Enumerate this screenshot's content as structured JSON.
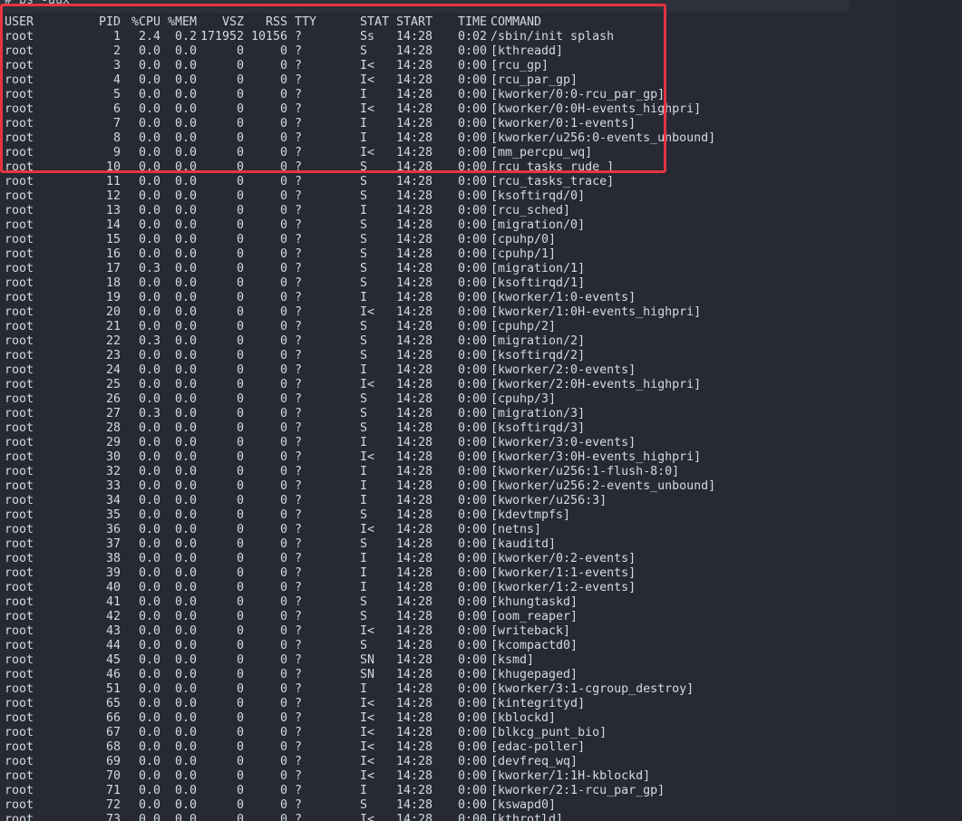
{
  "command": "# ps -aux",
  "columns": [
    "USER",
    "PID",
    "%CPU",
    "%MEM",
    "VSZ",
    "RSS",
    "TTY",
    "STAT",
    "START",
    "TIME",
    "COMMAND"
  ],
  "rows": [
    {
      "user": "root",
      "pid": "1",
      "cpu": "2.4",
      "mem": "0.2",
      "vsz": "171952",
      "rss": "10156",
      "tty": "?",
      "stat": "Ss",
      "start": "14:28",
      "time": "0:02",
      "cmd": "/sbin/init splash"
    },
    {
      "user": "root",
      "pid": "2",
      "cpu": "0.0",
      "mem": "0.0",
      "vsz": "0",
      "rss": "0",
      "tty": "?",
      "stat": "S",
      "start": "14:28",
      "time": "0:00",
      "cmd": "[kthreadd]"
    },
    {
      "user": "root",
      "pid": "3",
      "cpu": "0.0",
      "mem": "0.0",
      "vsz": "0",
      "rss": "0",
      "tty": "?",
      "stat": "I<",
      "start": "14:28",
      "time": "0:00",
      "cmd": "[rcu_gp]"
    },
    {
      "user": "root",
      "pid": "4",
      "cpu": "0.0",
      "mem": "0.0",
      "vsz": "0",
      "rss": "0",
      "tty": "?",
      "stat": "I<",
      "start": "14:28",
      "time": "0:00",
      "cmd": "[rcu_par_gp]"
    },
    {
      "user": "root",
      "pid": "5",
      "cpu": "0.0",
      "mem": "0.0",
      "vsz": "0",
      "rss": "0",
      "tty": "?",
      "stat": "I",
      "start": "14:28",
      "time": "0:00",
      "cmd": "[kworker/0:0-rcu_par_gp]"
    },
    {
      "user": "root",
      "pid": "6",
      "cpu": "0.0",
      "mem": "0.0",
      "vsz": "0",
      "rss": "0",
      "tty": "?",
      "stat": "I<",
      "start": "14:28",
      "time": "0:00",
      "cmd": "[kworker/0:0H-events_highpri]"
    },
    {
      "user": "root",
      "pid": "7",
      "cpu": "0.0",
      "mem": "0.0",
      "vsz": "0",
      "rss": "0",
      "tty": "?",
      "stat": "I",
      "start": "14:28",
      "time": "0:00",
      "cmd": "[kworker/0:1-events]"
    },
    {
      "user": "root",
      "pid": "8",
      "cpu": "0.0",
      "mem": "0.0",
      "vsz": "0",
      "rss": "0",
      "tty": "?",
      "stat": "I",
      "start": "14:28",
      "time": "0:00",
      "cmd": "[kworker/u256:0-events_unbound]"
    },
    {
      "user": "root",
      "pid": "9",
      "cpu": "0.0",
      "mem": "0.0",
      "vsz": "0",
      "rss": "0",
      "tty": "?",
      "stat": "I<",
      "start": "14:28",
      "time": "0:00",
      "cmd": "[mm_percpu_wq]"
    },
    {
      "user": "root",
      "pid": "10",
      "cpu": "0.0",
      "mem": "0.0",
      "vsz": "0",
      "rss": "0",
      "tty": "?",
      "stat": "S",
      "start": "14:28",
      "time": "0:00",
      "cmd": "[rcu_tasks_rude_]"
    },
    {
      "user": "root",
      "pid": "11",
      "cpu": "0.0",
      "mem": "0.0",
      "vsz": "0",
      "rss": "0",
      "tty": "?",
      "stat": "S",
      "start": "14:28",
      "time": "0:00",
      "cmd": "[rcu_tasks_trace]"
    },
    {
      "user": "root",
      "pid": "12",
      "cpu": "0.0",
      "mem": "0.0",
      "vsz": "0",
      "rss": "0",
      "tty": "?",
      "stat": "S",
      "start": "14:28",
      "time": "0:00",
      "cmd": "[ksoftirqd/0]"
    },
    {
      "user": "root",
      "pid": "13",
      "cpu": "0.0",
      "mem": "0.0",
      "vsz": "0",
      "rss": "0",
      "tty": "?",
      "stat": "I",
      "start": "14:28",
      "time": "0:00",
      "cmd": "[rcu_sched]"
    },
    {
      "user": "root",
      "pid": "14",
      "cpu": "0.0",
      "mem": "0.0",
      "vsz": "0",
      "rss": "0",
      "tty": "?",
      "stat": "S",
      "start": "14:28",
      "time": "0:00",
      "cmd": "[migration/0]"
    },
    {
      "user": "root",
      "pid": "15",
      "cpu": "0.0",
      "mem": "0.0",
      "vsz": "0",
      "rss": "0",
      "tty": "?",
      "stat": "S",
      "start": "14:28",
      "time": "0:00",
      "cmd": "[cpuhp/0]"
    },
    {
      "user": "root",
      "pid": "16",
      "cpu": "0.0",
      "mem": "0.0",
      "vsz": "0",
      "rss": "0",
      "tty": "?",
      "stat": "S",
      "start": "14:28",
      "time": "0:00",
      "cmd": "[cpuhp/1]"
    },
    {
      "user": "root",
      "pid": "17",
      "cpu": "0.3",
      "mem": "0.0",
      "vsz": "0",
      "rss": "0",
      "tty": "?",
      "stat": "S",
      "start": "14:28",
      "time": "0:00",
      "cmd": "[migration/1]"
    },
    {
      "user": "root",
      "pid": "18",
      "cpu": "0.0",
      "mem": "0.0",
      "vsz": "0",
      "rss": "0",
      "tty": "?",
      "stat": "S",
      "start": "14:28",
      "time": "0:00",
      "cmd": "[ksoftirqd/1]"
    },
    {
      "user": "root",
      "pid": "19",
      "cpu": "0.0",
      "mem": "0.0",
      "vsz": "0",
      "rss": "0",
      "tty": "?",
      "stat": "I",
      "start": "14:28",
      "time": "0:00",
      "cmd": "[kworker/1:0-events]"
    },
    {
      "user": "root",
      "pid": "20",
      "cpu": "0.0",
      "mem": "0.0",
      "vsz": "0",
      "rss": "0",
      "tty": "?",
      "stat": "I<",
      "start": "14:28",
      "time": "0:00",
      "cmd": "[kworker/1:0H-events_highpri]"
    },
    {
      "user": "root",
      "pid": "21",
      "cpu": "0.0",
      "mem": "0.0",
      "vsz": "0",
      "rss": "0",
      "tty": "?",
      "stat": "S",
      "start": "14:28",
      "time": "0:00",
      "cmd": "[cpuhp/2]"
    },
    {
      "user": "root",
      "pid": "22",
      "cpu": "0.3",
      "mem": "0.0",
      "vsz": "0",
      "rss": "0",
      "tty": "?",
      "stat": "S",
      "start": "14:28",
      "time": "0:00",
      "cmd": "[migration/2]"
    },
    {
      "user": "root",
      "pid": "23",
      "cpu": "0.0",
      "mem": "0.0",
      "vsz": "0",
      "rss": "0",
      "tty": "?",
      "stat": "S",
      "start": "14:28",
      "time": "0:00",
      "cmd": "[ksoftirqd/2]"
    },
    {
      "user": "root",
      "pid": "24",
      "cpu": "0.0",
      "mem": "0.0",
      "vsz": "0",
      "rss": "0",
      "tty": "?",
      "stat": "I",
      "start": "14:28",
      "time": "0:00",
      "cmd": "[kworker/2:0-events]"
    },
    {
      "user": "root",
      "pid": "25",
      "cpu": "0.0",
      "mem": "0.0",
      "vsz": "0",
      "rss": "0",
      "tty": "?",
      "stat": "I<",
      "start": "14:28",
      "time": "0:00",
      "cmd": "[kworker/2:0H-events_highpri]"
    },
    {
      "user": "root",
      "pid": "26",
      "cpu": "0.0",
      "mem": "0.0",
      "vsz": "0",
      "rss": "0",
      "tty": "?",
      "stat": "S",
      "start": "14:28",
      "time": "0:00",
      "cmd": "[cpuhp/3]"
    },
    {
      "user": "root",
      "pid": "27",
      "cpu": "0.3",
      "mem": "0.0",
      "vsz": "0",
      "rss": "0",
      "tty": "?",
      "stat": "S",
      "start": "14:28",
      "time": "0:00",
      "cmd": "[migration/3]"
    },
    {
      "user": "root",
      "pid": "28",
      "cpu": "0.0",
      "mem": "0.0",
      "vsz": "0",
      "rss": "0",
      "tty": "?",
      "stat": "S",
      "start": "14:28",
      "time": "0:00",
      "cmd": "[ksoftirqd/3]"
    },
    {
      "user": "root",
      "pid": "29",
      "cpu": "0.0",
      "mem": "0.0",
      "vsz": "0",
      "rss": "0",
      "tty": "?",
      "stat": "I",
      "start": "14:28",
      "time": "0:00",
      "cmd": "[kworker/3:0-events]"
    },
    {
      "user": "root",
      "pid": "30",
      "cpu": "0.0",
      "mem": "0.0",
      "vsz": "0",
      "rss": "0",
      "tty": "?",
      "stat": "I<",
      "start": "14:28",
      "time": "0:00",
      "cmd": "[kworker/3:0H-events_highpri]"
    },
    {
      "user": "root",
      "pid": "32",
      "cpu": "0.0",
      "mem": "0.0",
      "vsz": "0",
      "rss": "0",
      "tty": "?",
      "stat": "I",
      "start": "14:28",
      "time": "0:00",
      "cmd": "[kworker/u256:1-flush-8:0]"
    },
    {
      "user": "root",
      "pid": "33",
      "cpu": "0.0",
      "mem": "0.0",
      "vsz": "0",
      "rss": "0",
      "tty": "?",
      "stat": "I",
      "start": "14:28",
      "time": "0:00",
      "cmd": "[kworker/u256:2-events_unbound]"
    },
    {
      "user": "root",
      "pid": "34",
      "cpu": "0.0",
      "mem": "0.0",
      "vsz": "0",
      "rss": "0",
      "tty": "?",
      "stat": "I",
      "start": "14:28",
      "time": "0:00",
      "cmd": "[kworker/u256:3]"
    },
    {
      "user": "root",
      "pid": "35",
      "cpu": "0.0",
      "mem": "0.0",
      "vsz": "0",
      "rss": "0",
      "tty": "?",
      "stat": "S",
      "start": "14:28",
      "time": "0:00",
      "cmd": "[kdevtmpfs]"
    },
    {
      "user": "root",
      "pid": "36",
      "cpu": "0.0",
      "mem": "0.0",
      "vsz": "0",
      "rss": "0",
      "tty": "?",
      "stat": "I<",
      "start": "14:28",
      "time": "0:00",
      "cmd": "[netns]"
    },
    {
      "user": "root",
      "pid": "37",
      "cpu": "0.0",
      "mem": "0.0",
      "vsz": "0",
      "rss": "0",
      "tty": "?",
      "stat": "S",
      "start": "14:28",
      "time": "0:00",
      "cmd": "[kauditd]"
    },
    {
      "user": "root",
      "pid": "38",
      "cpu": "0.0",
      "mem": "0.0",
      "vsz": "0",
      "rss": "0",
      "tty": "?",
      "stat": "I",
      "start": "14:28",
      "time": "0:00",
      "cmd": "[kworker/0:2-events]"
    },
    {
      "user": "root",
      "pid": "39",
      "cpu": "0.0",
      "mem": "0.0",
      "vsz": "0",
      "rss": "0",
      "tty": "?",
      "stat": "I",
      "start": "14:28",
      "time": "0:00",
      "cmd": "[kworker/1:1-events]"
    },
    {
      "user": "root",
      "pid": "40",
      "cpu": "0.0",
      "mem": "0.0",
      "vsz": "0",
      "rss": "0",
      "tty": "?",
      "stat": "I",
      "start": "14:28",
      "time": "0:00",
      "cmd": "[kworker/1:2-events]"
    },
    {
      "user": "root",
      "pid": "41",
      "cpu": "0.0",
      "mem": "0.0",
      "vsz": "0",
      "rss": "0",
      "tty": "?",
      "stat": "S",
      "start": "14:28",
      "time": "0:00",
      "cmd": "[khungtaskd]"
    },
    {
      "user": "root",
      "pid": "42",
      "cpu": "0.0",
      "mem": "0.0",
      "vsz": "0",
      "rss": "0",
      "tty": "?",
      "stat": "S",
      "start": "14:28",
      "time": "0:00",
      "cmd": "[oom_reaper]"
    },
    {
      "user": "root",
      "pid": "43",
      "cpu": "0.0",
      "mem": "0.0",
      "vsz": "0",
      "rss": "0",
      "tty": "?",
      "stat": "I<",
      "start": "14:28",
      "time": "0:00",
      "cmd": "[writeback]"
    },
    {
      "user": "root",
      "pid": "44",
      "cpu": "0.0",
      "mem": "0.0",
      "vsz": "0",
      "rss": "0",
      "tty": "?",
      "stat": "S",
      "start": "14:28",
      "time": "0:00",
      "cmd": "[kcompactd0]"
    },
    {
      "user": "root",
      "pid": "45",
      "cpu": "0.0",
      "mem": "0.0",
      "vsz": "0",
      "rss": "0",
      "tty": "?",
      "stat": "SN",
      "start": "14:28",
      "time": "0:00",
      "cmd": "[ksmd]"
    },
    {
      "user": "root",
      "pid": "46",
      "cpu": "0.0",
      "mem": "0.0",
      "vsz": "0",
      "rss": "0",
      "tty": "?",
      "stat": "SN",
      "start": "14:28",
      "time": "0:00",
      "cmd": "[khugepaged]"
    },
    {
      "user": "root",
      "pid": "51",
      "cpu": "0.0",
      "mem": "0.0",
      "vsz": "0",
      "rss": "0",
      "tty": "?",
      "stat": "I",
      "start": "14:28",
      "time": "0:00",
      "cmd": "[kworker/3:1-cgroup_destroy]"
    },
    {
      "user": "root",
      "pid": "65",
      "cpu": "0.0",
      "mem": "0.0",
      "vsz": "0",
      "rss": "0",
      "tty": "?",
      "stat": "I<",
      "start": "14:28",
      "time": "0:00",
      "cmd": "[kintegrityd]"
    },
    {
      "user": "root",
      "pid": "66",
      "cpu": "0.0",
      "mem": "0.0",
      "vsz": "0",
      "rss": "0",
      "tty": "?",
      "stat": "I<",
      "start": "14:28",
      "time": "0:00",
      "cmd": "[kblockd]"
    },
    {
      "user": "root",
      "pid": "67",
      "cpu": "0.0",
      "mem": "0.0",
      "vsz": "0",
      "rss": "0",
      "tty": "?",
      "stat": "I<",
      "start": "14:28",
      "time": "0:00",
      "cmd": "[blkcg_punt_bio]"
    },
    {
      "user": "root",
      "pid": "68",
      "cpu": "0.0",
      "mem": "0.0",
      "vsz": "0",
      "rss": "0",
      "tty": "?",
      "stat": "I<",
      "start": "14:28",
      "time": "0:00",
      "cmd": "[edac-poller]"
    },
    {
      "user": "root",
      "pid": "69",
      "cpu": "0.0",
      "mem": "0.0",
      "vsz": "0",
      "rss": "0",
      "tty": "?",
      "stat": "I<",
      "start": "14:28",
      "time": "0:00",
      "cmd": "[devfreq_wq]"
    },
    {
      "user": "root",
      "pid": "70",
      "cpu": "0.0",
      "mem": "0.0",
      "vsz": "0",
      "rss": "0",
      "tty": "?",
      "stat": "I<",
      "start": "14:28",
      "time": "0:00",
      "cmd": "[kworker/1:1H-kblockd]"
    },
    {
      "user": "root",
      "pid": "71",
      "cpu": "0.0",
      "mem": "0.0",
      "vsz": "0",
      "rss": "0",
      "tty": "?",
      "stat": "I",
      "start": "14:28",
      "time": "0:00",
      "cmd": "[kworker/2:1-rcu_par_gp]"
    },
    {
      "user": "root",
      "pid": "72",
      "cpu": "0.0",
      "mem": "0.0",
      "vsz": "0",
      "rss": "0",
      "tty": "?",
      "stat": "S",
      "start": "14:28",
      "time": "0:00",
      "cmd": "[kswapd0]"
    },
    {
      "user": "root",
      "pid": "73",
      "cpu": "0.0",
      "mem": "0.0",
      "vsz": "0",
      "rss": "0",
      "tty": "?",
      "stat": "I<",
      "start": "14:28",
      "time": "0:00",
      "cmd": "[kthrotld]"
    }
  ],
  "colors": {
    "background": "#272a35",
    "text": "#d6d9e2",
    "highlight_border": "#e5353f",
    "prompt_symbol": "#e06c75"
  }
}
